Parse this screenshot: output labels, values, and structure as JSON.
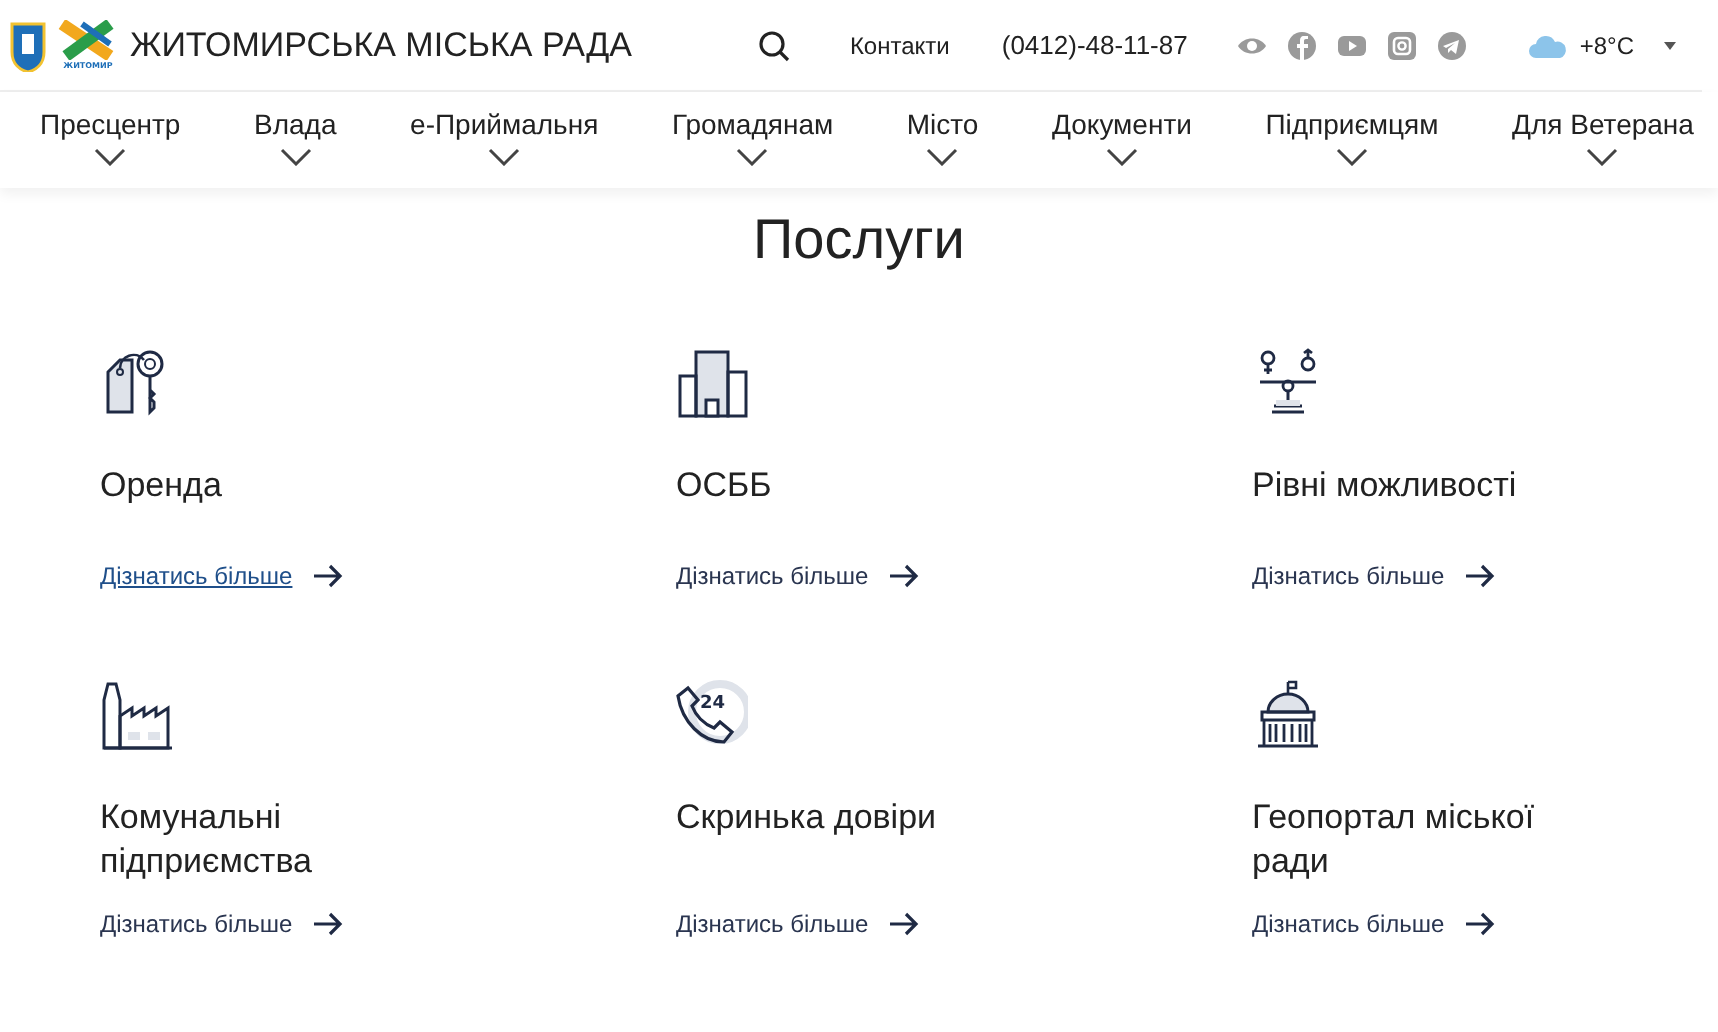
{
  "header": {
    "logo_title": "ЖИТОМИРСЬКА МІСЬКА РАДА",
    "logo_caption": "ЖИТОМИР",
    "contacts": "Контакти",
    "phone": "(0412)-48-11-87",
    "weather": "+8°C"
  },
  "nav": [
    {
      "label": "Пресцентр"
    },
    {
      "label": "Влада"
    },
    {
      "label": "е-Приймальня"
    },
    {
      "label": "Громадянам"
    },
    {
      "label": "Місто"
    },
    {
      "label": "Документи"
    },
    {
      "label": "Підприємцям"
    },
    {
      "label": "Для Ветерана"
    }
  ],
  "section_title": "Послуги",
  "cards": [
    {
      "title": "Оренда",
      "link": "Дізнатись більше",
      "hovered": true
    },
    {
      "title": "ОСББ",
      "link": "Дізнатись більше",
      "hovered": false
    },
    {
      "title": "Рівні можливості",
      "link": "Дізнатись більше",
      "hovered": false
    },
    {
      "title": "Комунальні підприємства",
      "link": "Дізнатись більше",
      "hovered": false
    },
    {
      "icon_text": "24",
      "title": "Скринька довіри",
      "link": "Дізнатись більше",
      "hovered": false
    },
    {
      "title": "Геопортал міської ради",
      "link": "Дізнатись більше",
      "hovered": false
    }
  ]
}
